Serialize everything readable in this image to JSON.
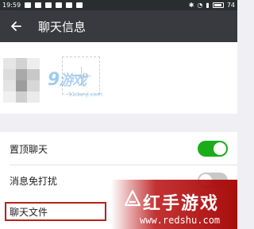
{
  "status_bar": {
    "time": "19:59",
    "battery": "74"
  },
  "app_bar": {
    "title": "聊天信息"
  },
  "watermark_top": {
    "text": "9",
    "cn": "游戏",
    "url": "91danji.com"
  },
  "settings": [
    {
      "label": "置顶聊天",
      "toggle": "on"
    },
    {
      "label": "消息免打扰",
      "toggle": "off"
    }
  ],
  "file_row": {
    "label": "聊天文件"
  },
  "watermark_bottom": {
    "text": "红手游戏",
    "url": "www.redshu.com"
  },
  "colors": {
    "toggle_on": "#1aad19",
    "app_bar": "#393a3f",
    "highlight": "#b3231c"
  }
}
